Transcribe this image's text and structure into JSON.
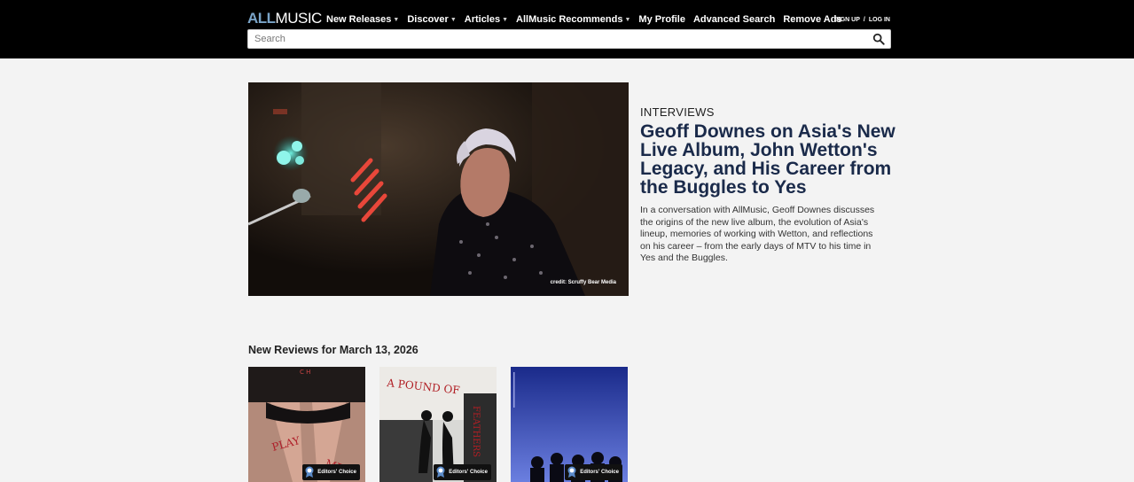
{
  "header": {
    "logo_all": "ALL",
    "logo_music": "MUSIC",
    "nav": [
      {
        "label": "New Releases",
        "has_dropdown": true
      },
      {
        "label": "Discover",
        "has_dropdown": true
      },
      {
        "label": "Articles",
        "has_dropdown": true
      },
      {
        "label": "AllMusic Recommends",
        "has_dropdown": true
      },
      {
        "label": "My Profile",
        "has_dropdown": false
      },
      {
        "label": "Advanced Search",
        "has_dropdown": false
      },
      {
        "label": "Remove Ads",
        "has_dropdown": false
      }
    ],
    "sign_up": "SIGN UP",
    "separator": "/",
    "log_in": "LOG IN",
    "search_placeholder": "Search"
  },
  "feature": {
    "kicker": "INTERVIEWS",
    "title": "Geoff Downes on Asia's New Live Album, John Wetton's Legacy, and His Career from the Buggles to Yes",
    "body": "In a conversation with AllMusic, Geoff Downes discusses the origins of the new live album, the evolution of Asia's lineup, memories of working with Wetton, and reflections on his career – from the early days of MTV to his time in Yes and the Buggles.",
    "image_credit": "credit: Scruffy Bear Media"
  },
  "reviews": {
    "section_title": "New Reviews for March 13, 2026",
    "albums": [
      {
        "badge": "Editors' Choice"
      },
      {
        "badge": "Editors' Choice"
      },
      {
        "badge": "Editors' Choice"
      }
    ]
  },
  "colors": {
    "topbar": "#000000",
    "logo_accent": "#7aa4c8",
    "title": "#1a2a4a",
    "page_bg": "#f3f3f3"
  }
}
